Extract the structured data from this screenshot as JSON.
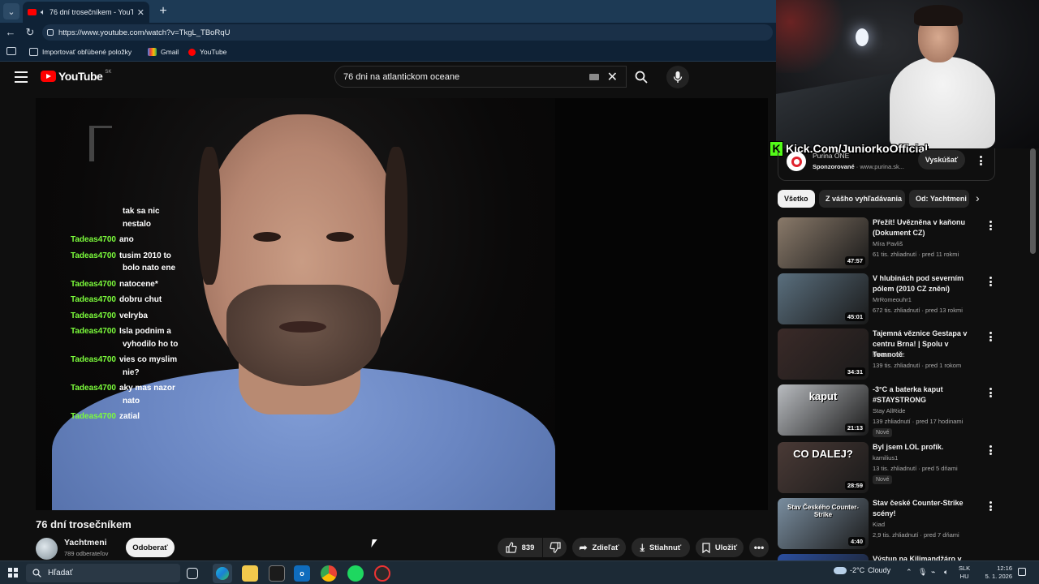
{
  "browser": {
    "tab_title": "76 dní trosečníkem - YouTube",
    "url": "https://www.youtube.com/watch?v=TkgL_TBoRqU",
    "bookmarks": [
      {
        "label": "Importovať obľúbené položky"
      },
      {
        "label": "Gmail"
      },
      {
        "label": "YouTube"
      }
    ]
  },
  "youtube": {
    "logo_text": "YouTube",
    "country_code": "SK",
    "search_value": "76 dni na atlantickom oceane"
  },
  "video": {
    "channel_bug": "1",
    "chat": [
      {
        "user": "",
        "message": "tak sa nic"
      },
      {
        "user": "",
        "message": "nestalo"
      },
      {
        "user": "Tadeas4700",
        "message": "ano"
      },
      {
        "user": "Tadeas4700",
        "message": "tusim 2010 to"
      },
      {
        "user": "",
        "message": "bolo nato ene"
      },
      {
        "user": "Tadeas4700",
        "message": "natocene*"
      },
      {
        "user": "Tadeas4700",
        "message": "dobru chut"
      },
      {
        "user": "Tadeas4700",
        "message": "velryba"
      },
      {
        "user": "Tadeas4700",
        "message": "Isla podnim a"
      },
      {
        "user": "",
        "message": "vyhodilo ho to"
      },
      {
        "user": "Tadeas4700",
        "message": "vies co myslim"
      },
      {
        "user": "",
        "message": "nie?"
      },
      {
        "user": "Tadeas4700",
        "message": "aky mas nazor"
      },
      {
        "user": "",
        "message": "nato"
      },
      {
        "user": "Tadeas4700",
        "message": "zatial"
      }
    ],
    "title": "76 dní trosečníkem",
    "channel": "Yachtmeni",
    "subscribers": "789 odberateľov",
    "subscribe_label": "Odoberať",
    "likes": "839",
    "share_label": "Zdieľať",
    "download_label": "Stiahnuť",
    "save_label": "Uložiť"
  },
  "overlay": {
    "kick_text": "Kick.Com/JuniorkoOfficial"
  },
  "sidebar": {
    "ad": {
      "name": "Purina ONE",
      "sponsored": "Sponzorované",
      "domain": "www.purina.sk...",
      "cta": "Vyskúšať"
    },
    "chips": [
      "Všetko",
      "Z vášho vyhľadávania",
      "Od: Yachtmeni"
    ],
    "recommendations": [
      {
        "title": "Přežít! Uvězněna v kaňonu (Dokument CZ)",
        "channel": "Míra Pavliš",
        "meta": "61 tis. zhliadnutí · pred 11 rokmi",
        "duration": "47:57",
        "badge": "",
        "thumb_color": "#8a7a6a"
      },
      {
        "title": "V hlubinách pod severním pólem  (2010 CZ znění)",
        "channel": "MrRomeouhr1",
        "meta": "672 tis. zhliadnutí · pred 13 rokmi",
        "duration": "45:01",
        "badge": "",
        "thumb_color": "#5a6f7e"
      },
      {
        "title": "Tajemná věznice Gestapa v centru Brna! | Spolu v Temnotě",
        "channel": "MAD ZONE",
        "meta": "139 tis. zhliadnutí · pred 1 rokom",
        "duration": "34:31",
        "badge": "",
        "thumb_color": "#3a2a28"
      },
      {
        "title": "-3°C a baterka kaput #STAYSTRONG",
        "channel": "Stay AllRide",
        "meta": "139 zhliadnutí · pred 17 hodinami",
        "duration": "21:13",
        "badge": "Nové",
        "thumb_color": "#b9bcc0",
        "thumb_text": "kaput"
      },
      {
        "title": "Byl jsem LOL profík.",
        "channel": "kamilius1",
        "meta": "13 tis. zhliadnutí · pred 5 dňami",
        "duration": "28:59",
        "badge": "Nové",
        "thumb_color": "#4a3a36",
        "thumb_text": "CO DALEJ?"
      },
      {
        "title": "Stav české Counter-Strike scény!",
        "channel": "Kiad",
        "meta": "2,9 tis. zhliadnutí · pred 7 dňami",
        "duration": "4:40",
        "badge": "",
        "thumb_color": "#7a8ea0",
        "thumb_text": "Stav Českého Counter-Strike"
      },
      {
        "title": "Výstup na Kilimandžáro v",
        "channel": "",
        "meta": "",
        "duration": "",
        "badge": "",
        "thumb_color": "#2b4fa0",
        "thumb_text": "KILIMANJARO"
      }
    ]
  },
  "taskbar": {
    "search_placeholder": "Hľadať",
    "weather_temp": "-2°C",
    "weather_desc": "Cloudy",
    "lang_1": "SLK",
    "lang_2": "HU",
    "time": "12:16",
    "date": "5. 1. 2026"
  }
}
